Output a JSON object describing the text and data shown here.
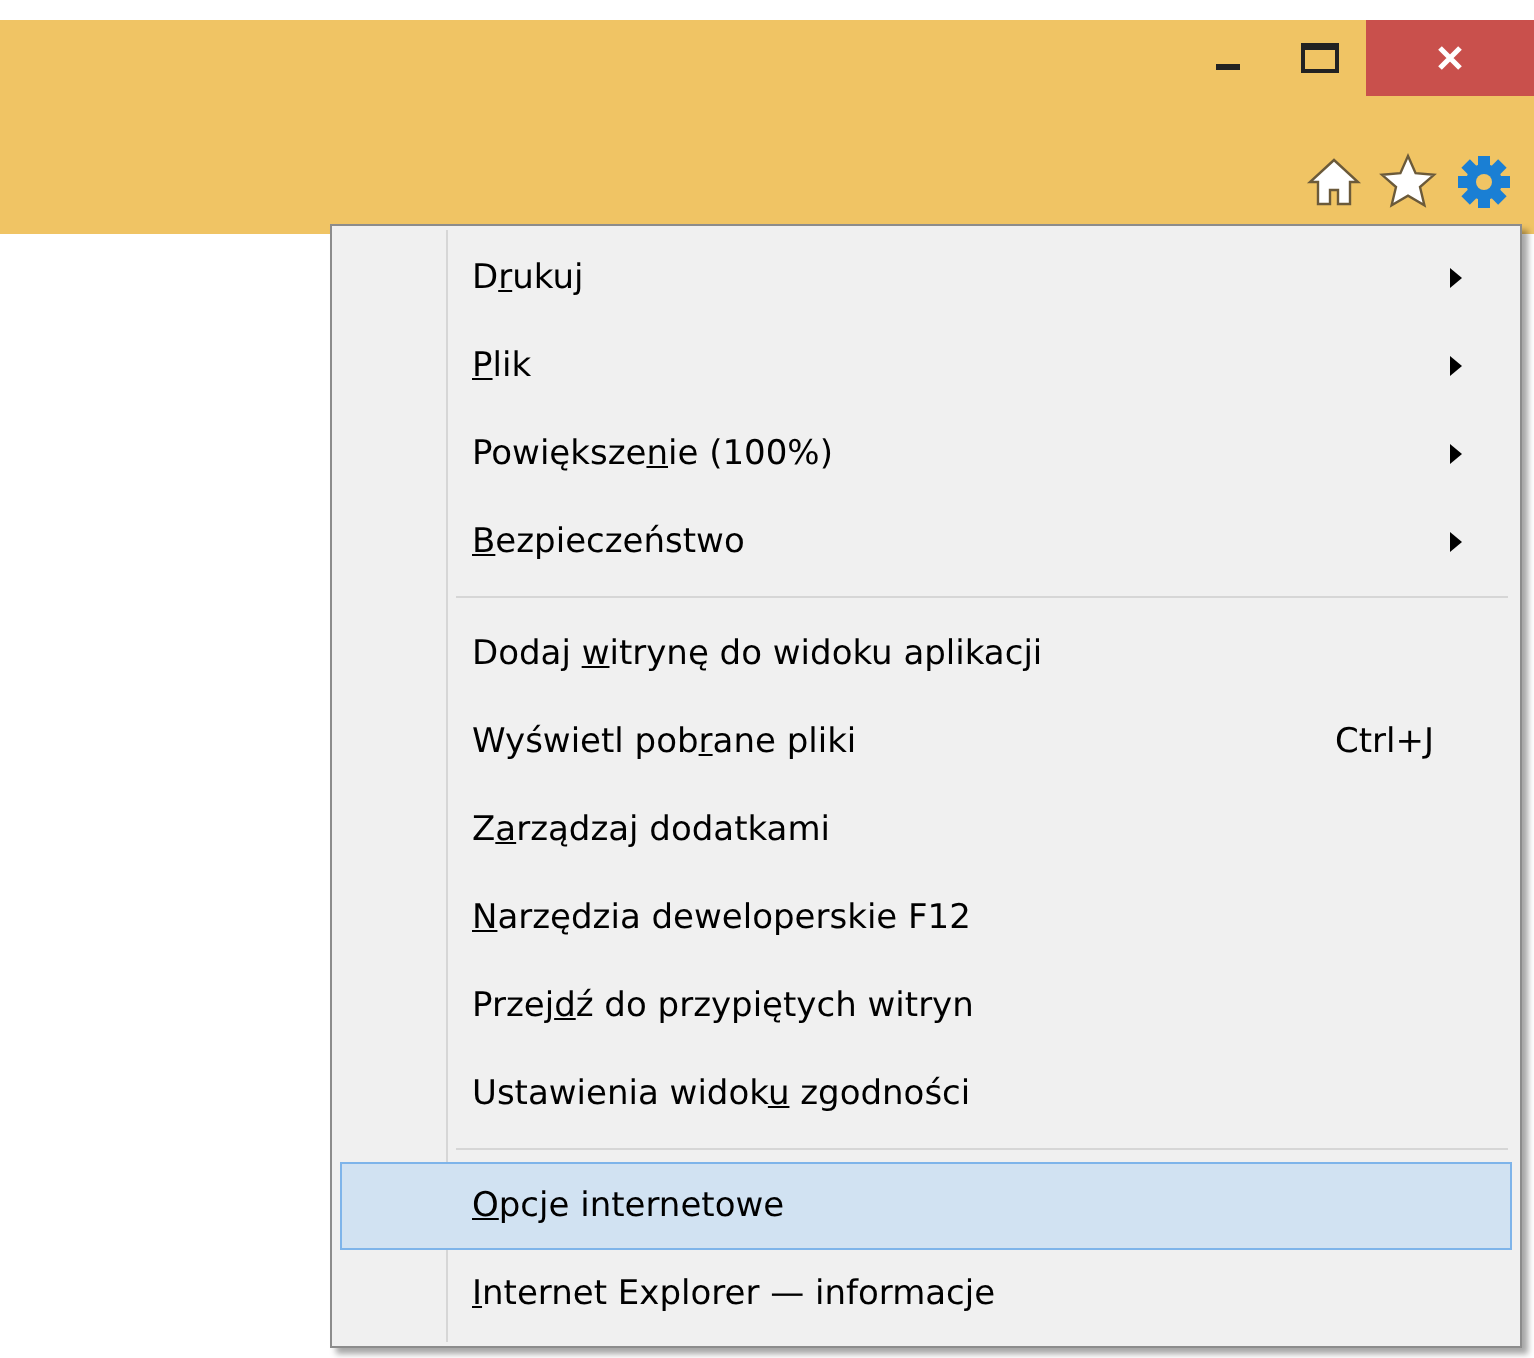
{
  "menu": {
    "groups": [
      {
        "items": [
          {
            "label": {
              "before": "D",
              "key": "r",
              "after": "ukuj"
            },
            "submenu": true,
            "selected": false
          },
          {
            "label": {
              "key": "P",
              "after": "lik"
            },
            "submenu": true,
            "selected": false
          },
          {
            "label": {
              "before": "Powiększe",
              "key": "n",
              "after": "ie (100%)"
            },
            "submenu": true,
            "selected": false
          },
          {
            "label": {
              "key": "B",
              "after": "ezpieczeństwo"
            },
            "submenu": true,
            "selected": false
          }
        ]
      },
      {
        "items": [
          {
            "label": {
              "before": "Dodaj ",
              "key": "w",
              "after": "itrynę do widoku aplikacji"
            },
            "submenu": false,
            "selected": false
          },
          {
            "label": {
              "before": "Wyświetl pob",
              "key": "r",
              "after": "ane pliki"
            },
            "submenu": false,
            "shortcut": "Ctrl+J",
            "selected": false
          },
          {
            "label": {
              "before": "Z",
              "key": "a",
              "after": "rządzaj dodatkami"
            },
            "submenu": false,
            "selected": false
          },
          {
            "label": {
              "key": "N",
              "after": "arzędzia deweloperskie F12"
            },
            "submenu": false,
            "selected": false
          },
          {
            "label": {
              "before": "Przej",
              "key": "d",
              "after": "ź do przypiętych witryn"
            },
            "submenu": false,
            "selected": false
          },
          {
            "label": {
              "before": "Ustawienia widok",
              "key": "u",
              "after": " zgodności"
            },
            "submenu": false,
            "selected": false
          }
        ]
      },
      {
        "items": [
          {
            "label": {
              "key": "O",
              "after": "pcje internetowe"
            },
            "submenu": false,
            "selected": true
          },
          {
            "label": {
              "key": "I",
              "after": "nternet Explorer — informacje"
            },
            "submenu": false,
            "selected": false
          }
        ]
      }
    ]
  }
}
